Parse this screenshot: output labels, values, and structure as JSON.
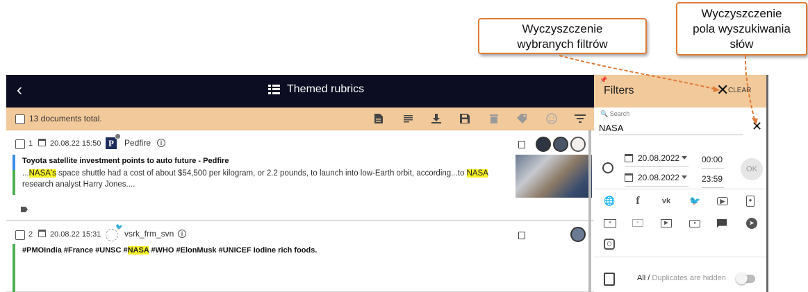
{
  "callouts": {
    "filters_clear": [
      "Wyczyszczenie",
      "wybranych filtrów"
    ],
    "search_clear": [
      "Wyczyszczenie",
      "pola wyszukiwania",
      "słów"
    ]
  },
  "header": {
    "back_icon": "chevron-left-icon",
    "title": "Themed rubrics"
  },
  "toolbar": {
    "count_text": "13 documents total.",
    "icons": [
      "document-icon",
      "lines-icon",
      "download-icon",
      "save-icon",
      "trash-icon",
      "tag-icon",
      "smile-icon",
      "filter-icon"
    ]
  },
  "documents": [
    {
      "index": "1",
      "date": "20.08.22 15:50",
      "source": "Pedfire",
      "source_icon": "pedfire-logo-icon",
      "headline": "Toyota satellite investment points to auto future - Pedfire",
      "snippet_parts": [
        "...",
        "NASA's",
        " space shuttle had a cost of about $54,500 per kilogram, or 2.2 pounds, to launch into low-Earth orbit, according...to ",
        "NASA",
        " research analyst Harry Jones...."
      ],
      "bar_colors": [
        "#3a8ee6",
        "#4caf50"
      ]
    },
    {
      "index": "2",
      "date": "20.08.22 15:31",
      "source": "vsrk_frm_svn",
      "source_icon": "twitter-user-icon",
      "headline_parts": [
        "#PMOIndia #France #UNSC #",
        "NASA",
        " #WHO #ElonMusk #UNICEF Iodine rich foods."
      ],
      "bar_colors": [
        "#4caf50"
      ]
    }
  ],
  "filters": {
    "title": "Filters",
    "clear_label": "CLEAR",
    "search_label": "Search",
    "search_value": "NASA",
    "date_from": "20.08.2022",
    "time_from": "00:00",
    "date_to": "20.08.2022",
    "time_to": "23:59",
    "ok_label": "OK",
    "sources": [
      "globe-icon",
      "facebook-icon",
      "vk-icon",
      "twitter-icon",
      "youtube-icon",
      "contact-icon",
      "newspaper-icon",
      "comment-icon",
      "tv-icon",
      "radio-icon",
      "chat-icon",
      "telegram-icon",
      "instagram-icon"
    ],
    "duplicates_all": "All /",
    "duplicates_hidden": "Duplicates are hidden"
  },
  "colors": {
    "topbar": "#0c0c22",
    "accent": "#f2c99a",
    "callout_border": "#e07b39",
    "highlight": "#f7f12a"
  }
}
